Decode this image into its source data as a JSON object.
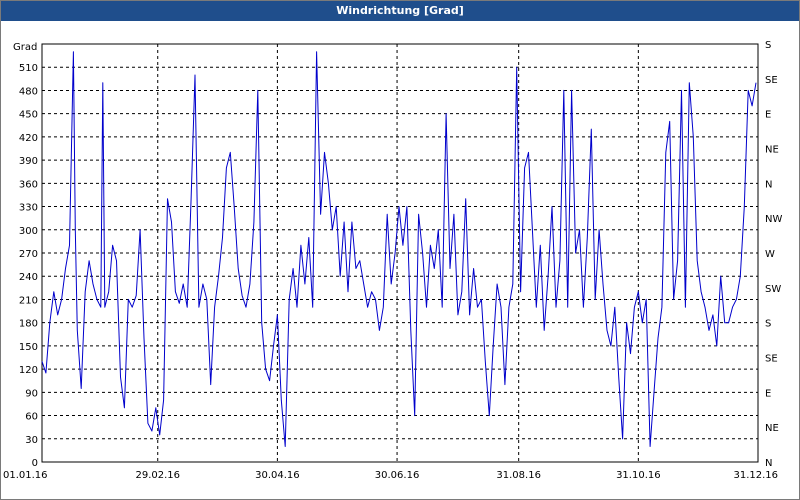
{
  "window": {
    "title": "Windrichtung [Grad]"
  },
  "chart_data": {
    "type": "line",
    "title": "Windrichtung [Grad]",
    "ylabel": "Grad",
    "ylim": [
      0,
      540
    ],
    "y_ticks": [
      0,
      30,
      60,
      90,
      120,
      150,
      180,
      210,
      240,
      270,
      300,
      330,
      360,
      390,
      420,
      450,
      480,
      510
    ],
    "right_ticks": [
      "N",
      "NE",
      "E",
      "SE",
      "S",
      "SW",
      "W",
      "NW",
      "N",
      "NE",
      "E",
      "SE",
      "S"
    ],
    "x_tick_labels": [
      "01.01.16",
      "29.02.16",
      "30.04.16",
      "30.06.16",
      "31.08.16",
      "31.10.16",
      "31.12.16"
    ],
    "x_tick_days": [
      0,
      59,
      120,
      181,
      243,
      304,
      365
    ],
    "xlim_days": [
      0,
      365
    ],
    "grid": true,
    "line_color": "#0000cc",
    "series": [
      {
        "x_days": [
          0,
          2,
          4,
          6,
          8,
          10,
          12,
          14,
          16,
          17,
          18,
          20,
          22,
          24,
          26,
          28,
          30,
          31,
          32,
          34,
          36,
          38,
          40,
          42,
          44,
          46,
          48,
          50,
          52,
          54,
          56,
          58,
          60,
          62,
          64,
          66,
          68,
          70,
          72,
          74,
          76,
          78,
          80,
          82,
          84,
          86,
          88,
          90,
          92,
          94,
          96,
          98,
          100,
          102,
          104,
          106,
          108,
          110,
          112,
          114,
          116,
          118,
          120,
          122,
          124,
          126,
          128,
          130,
          132,
          134,
          136,
          138,
          140,
          142,
          144,
          146,
          148,
          150,
          152,
          154,
          156,
          158,
          160,
          162,
          164,
          166,
          168,
          170,
          172,
          174,
          176,
          178,
          180,
          182,
          184,
          186,
          188,
          190,
          192,
          194,
          196,
          198,
          200,
          202,
          204,
          206,
          208,
          210,
          212,
          214,
          216,
          218,
          220,
          222,
          224,
          226,
          228,
          230,
          232,
          234,
          236,
          238,
          240,
          242,
          244,
          246,
          248,
          250,
          252,
          254,
          256,
          258,
          260,
          262,
          264,
          266,
          268,
          270,
          272,
          274,
          276,
          278,
          280,
          282,
          284,
          286,
          288,
          290,
          292,
          294,
          296,
          298,
          300,
          302,
          304,
          306,
          308,
          310,
          312,
          314,
          316,
          318,
          320,
          322,
          324,
          326,
          328,
          330,
          332,
          334,
          336,
          338,
          340,
          342,
          344,
          346,
          348,
          350,
          352,
          354,
          356,
          358,
          360,
          362,
          364,
          365
        ],
        "values": [
          130,
          115,
          180,
          220,
          190,
          210,
          250,
          280,
          530,
          300,
          170,
          95,
          220,
          260,
          230,
          210,
          200,
          490,
          200,
          220,
          280,
          260,
          110,
          70,
          210,
          200,
          215,
          300,
          160,
          50,
          40,
          70,
          35,
          80,
          340,
          310,
          220,
          205,
          230,
          200,
          340,
          500,
          200,
          230,
          210,
          100,
          200,
          240,
          290,
          380,
          400,
          330,
          250,
          215,
          200,
          230,
          310,
          480,
          180,
          120,
          105,
          150,
          190,
          80,
          20,
          210,
          250,
          200,
          280,
          230,
          290,
          200,
          530,
          320,
          400,
          360,
          300,
          330,
          240,
          310,
          220,
          310,
          250,
          260,
          230,
          200,
          220,
          210,
          170,
          200,
          320,
          230,
          270,
          330,
          280,
          330,
          170,
          60,
          320,
          270,
          200,
          280,
          250,
          300,
          200,
          450,
          250,
          320,
          190,
          220,
          340,
          190,
          250,
          200,
          210,
          130,
          60,
          150,
          230,
          200,
          100,
          200,
          230,
          510,
          220,
          380,
          400,
          300,
          200,
          280,
          170,
          240,
          330,
          200,
          260,
          480,
          200,
          480,
          270,
          300,
          200,
          290,
          430,
          210,
          300,
          230,
          170,
          150,
          200,
          110,
          30,
          180,
          140,
          200,
          220,
          180,
          210,
          20,
          90,
          160,
          200,
          400,
          440,
          210,
          260,
          480,
          200,
          490,
          420,
          260,
          220,
          200,
          170,
          190,
          150,
          240,
          180,
          180,
          200,
          210,
          240,
          330,
          480,
          460,
          490
        ]
      }
    ]
  }
}
